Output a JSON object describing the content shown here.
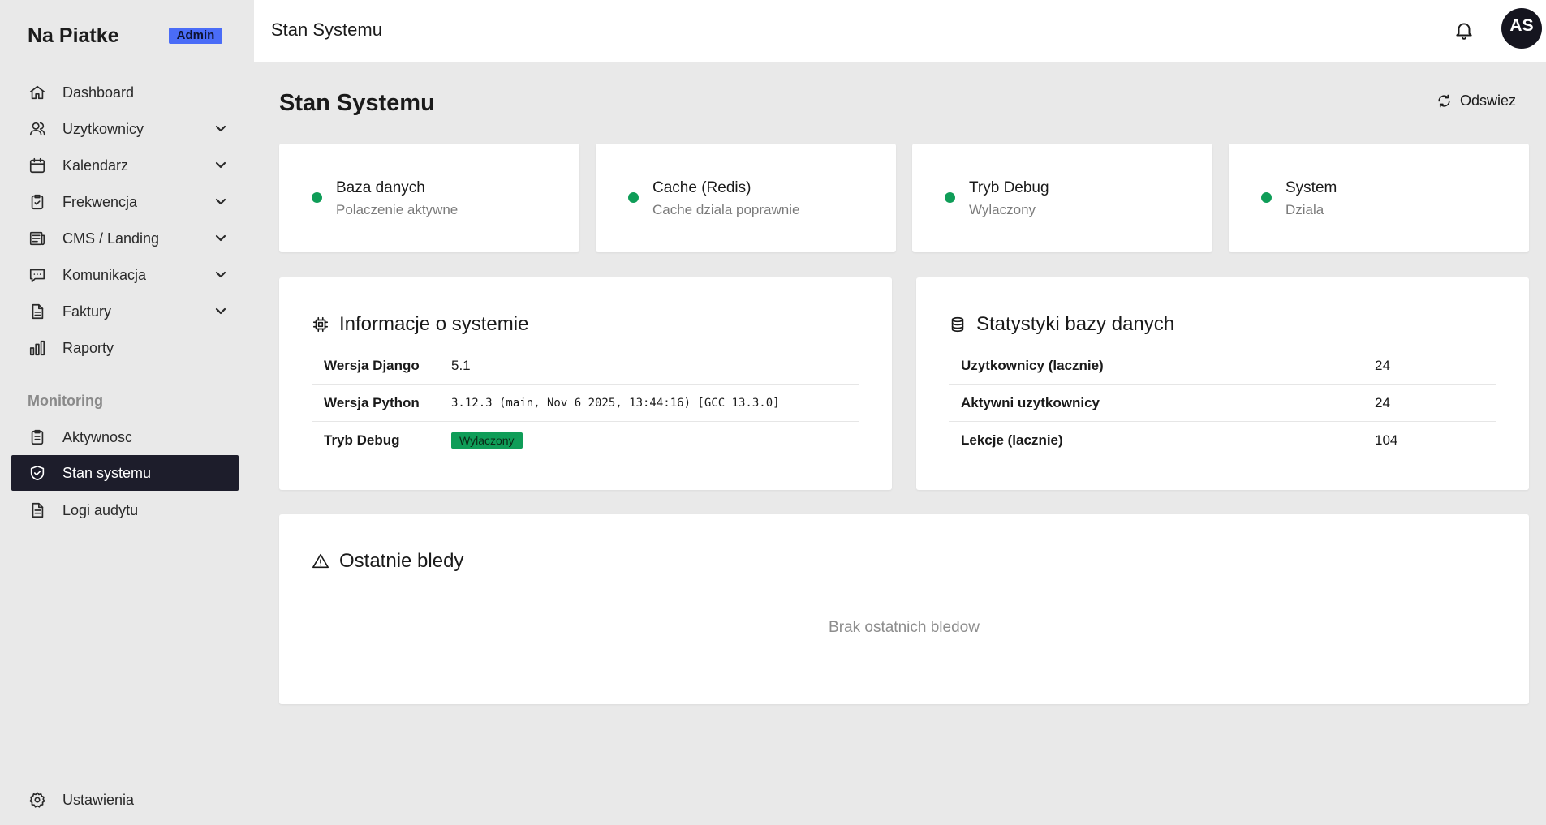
{
  "brand": {
    "name": "Na Piatke",
    "badge": "Admin"
  },
  "sidebar": {
    "items": [
      {
        "label": "Dashboard",
        "icon": "home-icon"
      },
      {
        "label": "Uzytkownicy",
        "icon": "users-icon",
        "expandable": true
      },
      {
        "label": "Kalendarz",
        "icon": "calendar-icon",
        "expandable": true
      },
      {
        "label": "Frekwencja",
        "icon": "clipboard-check-icon",
        "expandable": true
      },
      {
        "label": "CMS / Landing",
        "icon": "newspaper-icon",
        "expandable": true
      },
      {
        "label": "Komunikacja",
        "icon": "chat-icon",
        "expandable": true
      },
      {
        "label": "Faktury",
        "icon": "document-icon",
        "expandable": true
      },
      {
        "label": "Raporty",
        "icon": "bar-chart-icon"
      }
    ],
    "section_label": "Monitoring",
    "monitoring_items": [
      {
        "label": "Aktywnosc",
        "icon": "clipboard-list-icon"
      },
      {
        "label": "Stan systemu",
        "icon": "shield-check-icon",
        "active": true
      },
      {
        "label": "Logi audytu",
        "icon": "document-text-icon"
      }
    ],
    "footer_item": {
      "label": "Ustawienia",
      "icon": "gear-icon"
    }
  },
  "topbar": {
    "title": "Stan Systemu",
    "avatar_initials": "AS"
  },
  "main": {
    "title": "Stan Systemu",
    "refresh_label": "Odswiez",
    "status_cards": [
      {
        "title": "Baza danych",
        "subtitle": "Polaczenie aktywne",
        "status_color": "#0f9d58"
      },
      {
        "title": "Cache (Redis)",
        "subtitle": "Cache dziala poprawnie",
        "status_color": "#0f9d58"
      },
      {
        "title": "Tryb Debug",
        "subtitle": "Wylaczony",
        "status_color": "#0f9d58"
      },
      {
        "title": "System",
        "subtitle": "Dziala",
        "status_color": "#0f9d58"
      }
    ],
    "system_info": {
      "title": "Informacje o systemie",
      "rows": [
        {
          "key": "Wersja Django",
          "value": "5.1"
        },
        {
          "key": "Wersja Python",
          "value": "3.12.3 (main, Nov 6 2025, 13:44:16) [GCC 13.3.0]"
        },
        {
          "key": "Tryb Debug",
          "value": "Wylaczony"
        }
      ]
    },
    "db_stats": {
      "title": "Statystyki bazy danych",
      "rows": [
        {
          "key": "Uzytkownicy (lacznie)",
          "value": "24"
        },
        {
          "key": "Aktywni uzytkownicy",
          "value": "24"
        },
        {
          "key": "Lekcje (lacznie)",
          "value": "104"
        }
      ]
    },
    "recent_errors": {
      "title": "Ostatnie bledy",
      "empty_message": "Brak ostatnich bledow"
    }
  },
  "colors": {
    "accent": "#4a6cf7",
    "active_bg": "#1d1d2b",
    "ok": "#0f9d58"
  }
}
